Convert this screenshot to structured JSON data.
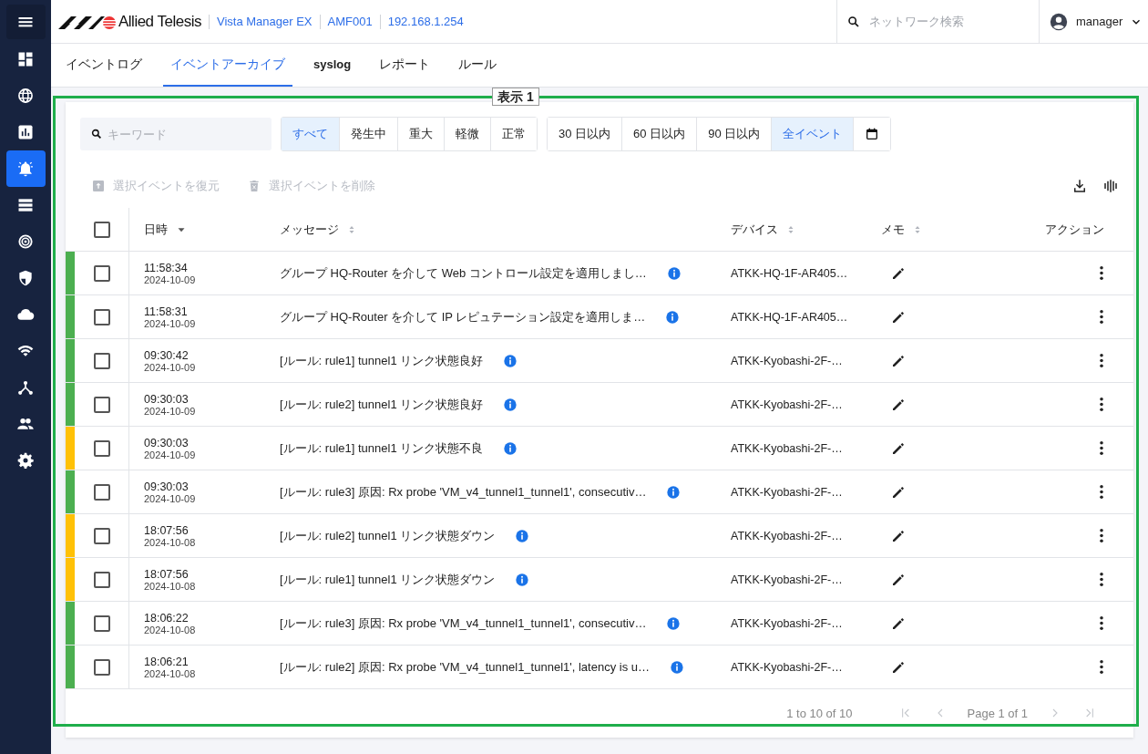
{
  "sidebar": {
    "items": [
      {
        "selected": false
      },
      {
        "selected": false
      },
      {
        "selected": false
      },
      {
        "selected": true
      },
      {
        "selected": false
      },
      {
        "selected": false
      },
      {
        "selected": false
      },
      {
        "selected": false
      },
      {
        "selected": false
      },
      {
        "selected": false
      },
      {
        "selected": false
      },
      {
        "selected": false
      }
    ]
  },
  "header": {
    "logo": "Allied Telesis",
    "breadcrumbs": [
      "Vista Manager EX",
      "AMF001",
      "192.168.1.254"
    ],
    "search": {
      "placeholder": "ネットワーク検索"
    },
    "user": "manager"
  },
  "tabs": [
    {
      "label": "イベントログ",
      "selected": false
    },
    {
      "label": "イベントアーカイブ",
      "selected": true
    },
    {
      "label": "syslog",
      "selected": false
    },
    {
      "label": "レポート",
      "selected": false
    },
    {
      "label": "ルール",
      "selected": false
    }
  ],
  "annotation": {
    "label": "表示 1"
  },
  "keyword": {
    "placeholder": "キーワード"
  },
  "severity_filters": [
    {
      "label": "すべて",
      "selected": true
    },
    {
      "label": "発生中",
      "selected": false
    },
    {
      "label": "重大",
      "selected": false
    },
    {
      "label": "軽微",
      "selected": false
    },
    {
      "label": "正常",
      "selected": false
    }
  ],
  "period_filters": [
    {
      "label": "30 日以内",
      "selected": false
    },
    {
      "label": "60 日以内",
      "selected": false
    },
    {
      "label": "90 日以内",
      "selected": false
    },
    {
      "label": "全イベント",
      "selected": true
    }
  ],
  "actions": [
    {
      "label": "選択イベントを復元",
      "disabled": true
    },
    {
      "label": "選択イベントを削除",
      "disabled": true
    }
  ],
  "table": {
    "columns": [
      {
        "label": "日時"
      },
      {
        "label": "メッセージ"
      },
      {
        "label": "デバイス"
      },
      {
        "label": "メモ"
      },
      {
        "label": "アクション"
      }
    ],
    "header_checked": false,
    "rows": [
      {
        "color": "#4caf50",
        "checked": false,
        "time": "11:58:34",
        "date": "2024-10-09",
        "message": "グループ HQ-Router を介して Web コントロール設定を適用しまし…",
        "device": "ATKK-HQ-1F-AR405…"
      },
      {
        "color": "#4caf50",
        "checked": false,
        "time": "11:58:31",
        "date": "2024-10-09",
        "message": "グループ HQ-Router を介して IP レピュテーション設定を適用しま…",
        "device": "ATKK-HQ-1F-AR405…"
      },
      {
        "color": "#4caf50",
        "checked": false,
        "time": "09:30:42",
        "date": "2024-10-09",
        "message": "[ルール: rule1] tunnel1 リンク状態良好",
        "device": "ATKK-Kyobashi-2F-…"
      },
      {
        "color": "#4caf50",
        "checked": false,
        "time": "09:30:03",
        "date": "2024-10-09",
        "message": "[ルール: rule2] tunnel1 リンク状態良好",
        "device": "ATKK-Kyobashi-2F-…"
      },
      {
        "color": "#ffc107",
        "checked": false,
        "time": "09:30:03",
        "date": "2024-10-09",
        "message": "[ルール: rule1] tunnel1 リンク状態不良",
        "device": "ATKK-Kyobashi-2F-…"
      },
      {
        "color": "#4caf50",
        "checked": false,
        "time": "09:30:03",
        "date": "2024-10-09",
        "message": "[ルール: rule3] 原因: Rx probe 'VM_v4_tunnel1_tunnel1', consecutiv…",
        "device": "ATKK-Kyobashi-2F-…"
      },
      {
        "color": "#ffc107",
        "checked": false,
        "time": "18:07:56",
        "date": "2024-10-08",
        "message": "[ルール: rule2] tunnel1 リンク状態ダウン",
        "device": "ATKK-Kyobashi-2F-…"
      },
      {
        "color": "#ffc107",
        "checked": false,
        "time": "18:07:56",
        "date": "2024-10-08",
        "message": "[ルール: rule1] tunnel1 リンク状態ダウン",
        "device": "ATKK-Kyobashi-2F-…"
      },
      {
        "color": "#4caf50",
        "checked": false,
        "time": "18:06:22",
        "date": "2024-10-08",
        "message": "[ルール: rule3] 原因: Rx probe 'VM_v4_tunnel1_tunnel1', consecutiv…",
        "device": "ATKK-Kyobashi-2F-…"
      },
      {
        "color": "#4caf50",
        "checked": false,
        "time": "18:06:21",
        "date": "2024-10-08",
        "message": "[ルール: rule2] 原因: Rx probe 'VM_v4_tunnel1_tunnel1', latency is u…",
        "device": "ATKK-Kyobashi-2F-…"
      }
    ]
  },
  "pagination": {
    "range": "1 to 10 of 10",
    "page": "Page 1 of 1"
  }
}
